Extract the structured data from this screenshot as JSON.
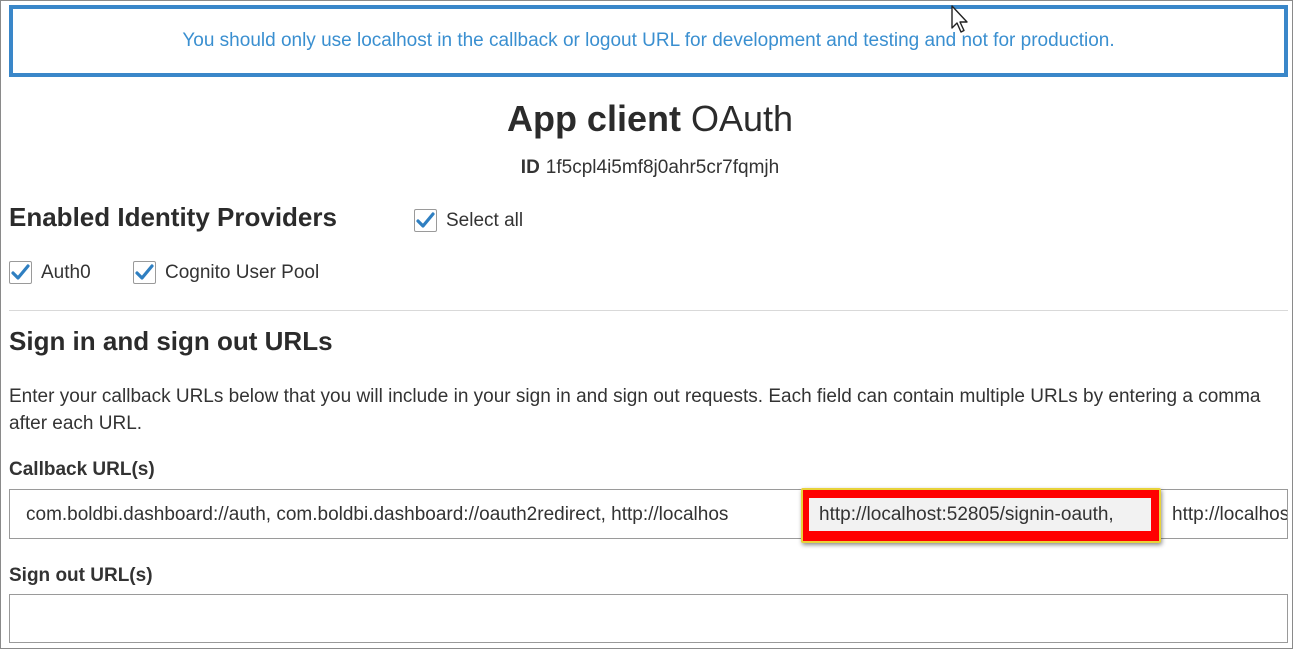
{
  "alert": {
    "message": "You should only use localhost in the callback or logout URL for development and testing and not for production."
  },
  "header": {
    "title_bold": "App client",
    "title_normal": "OAuth",
    "id_label": "ID",
    "id_value": "1f5cpl4i5mf8j0ahr5cr7fqmjh"
  },
  "identity_providers": {
    "heading": "Enabled Identity Providers",
    "select_all_label": "Select all",
    "select_all_checked": true,
    "providers": [
      {
        "label": "Auth0",
        "checked": true
      },
      {
        "label": "Cognito User Pool",
        "checked": true
      }
    ]
  },
  "sign_urls": {
    "heading": "Sign in and sign out URLs",
    "description": "Enter your callback URLs below that you will include in your sign in and sign out requests. Each field can contain multiple URLs by entering a comma after each URL.",
    "callback_label": "Callback URL(s)",
    "callback_value_prefix": "com.boldbi.dashboard://auth, com.boldbi.dashboard://oauth2redirect, http://localhos",
    "callback_value_highlight": "http://localhost:52805/signin-oauth,",
    "callback_value_suffix": "http://localhos",
    "signout_label": "Sign out URL(s)",
    "signout_value": ""
  },
  "colors": {
    "alert_border": "#3a87c9",
    "alert_text": "#3a8fd0",
    "checkbox_check": "#2f7fc1",
    "highlight_red": "#ff0000",
    "highlight_border": "#e8d23a"
  },
  "icons": {
    "cursor": "mouse-pointer-icon",
    "checkmark": "checkmark-icon"
  }
}
